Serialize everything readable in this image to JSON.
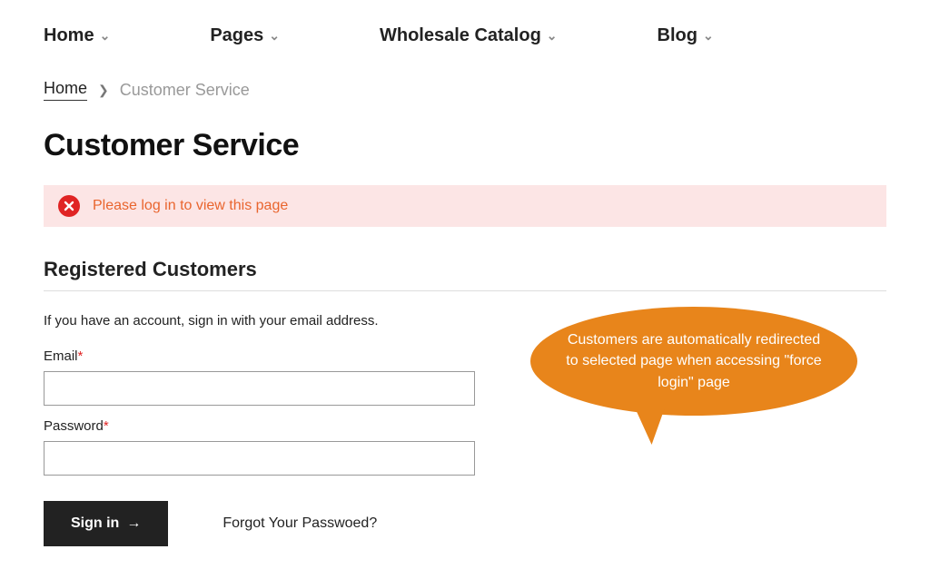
{
  "nav": {
    "items": [
      {
        "label": "Home"
      },
      {
        "label": "Pages"
      },
      {
        "label": "Wholesale Catalog"
      },
      {
        "label": "Blog"
      }
    ]
  },
  "breadcrumb": {
    "home": "Home",
    "current": "Customer Service"
  },
  "page": {
    "title": "Customer Service"
  },
  "alert": {
    "message": "Please log in to view this page"
  },
  "login": {
    "section_title": "Registered Customers",
    "description": "If you have an account, sign in with your email address.",
    "email_label": "Email",
    "password_label": "Password",
    "signin_button": "Sign in",
    "forgot_link": "Forgot Your Passwoed?",
    "email_value": "",
    "password_value": ""
  },
  "callout": {
    "text": "Customers are automatically redirected to selected page when accessing \"force login\" page"
  },
  "colors": {
    "accent": "#e8851b",
    "error": "#e02424",
    "alert_bg": "#fce5e5"
  }
}
